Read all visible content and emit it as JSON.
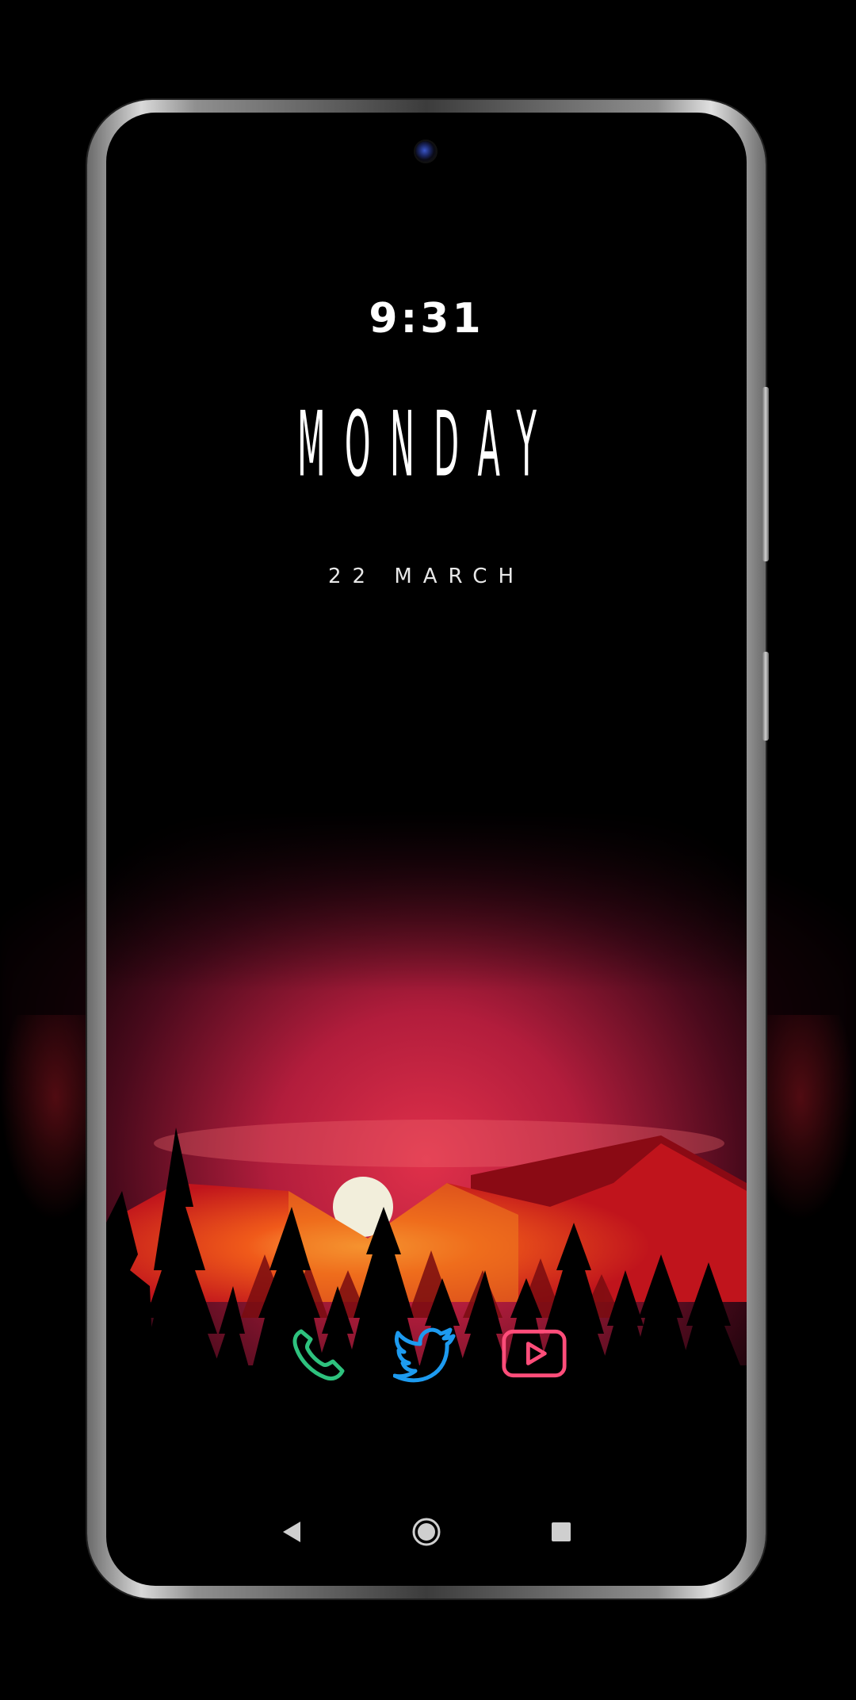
{
  "lockscreen": {
    "time": "9:31",
    "day": "MONDAY",
    "date": "22 MARCH"
  },
  "dock": {
    "apps": [
      {
        "name": "phone",
        "icon": "phone-icon",
        "color": "#2ec27e"
      },
      {
        "name": "twitter",
        "icon": "twitter-icon",
        "color": "#1d9bf0"
      },
      {
        "name": "youtube",
        "icon": "youtube-icon",
        "color": "#ff4d7a"
      }
    ]
  },
  "navigation": {
    "back": "back-icon",
    "home": "home-icon",
    "recents": "recents-icon"
  },
  "colors": {
    "background": "#000000",
    "sky_red": "#b0203a",
    "sun": "#f2eedb",
    "mountain_orange": "#e8401c"
  }
}
